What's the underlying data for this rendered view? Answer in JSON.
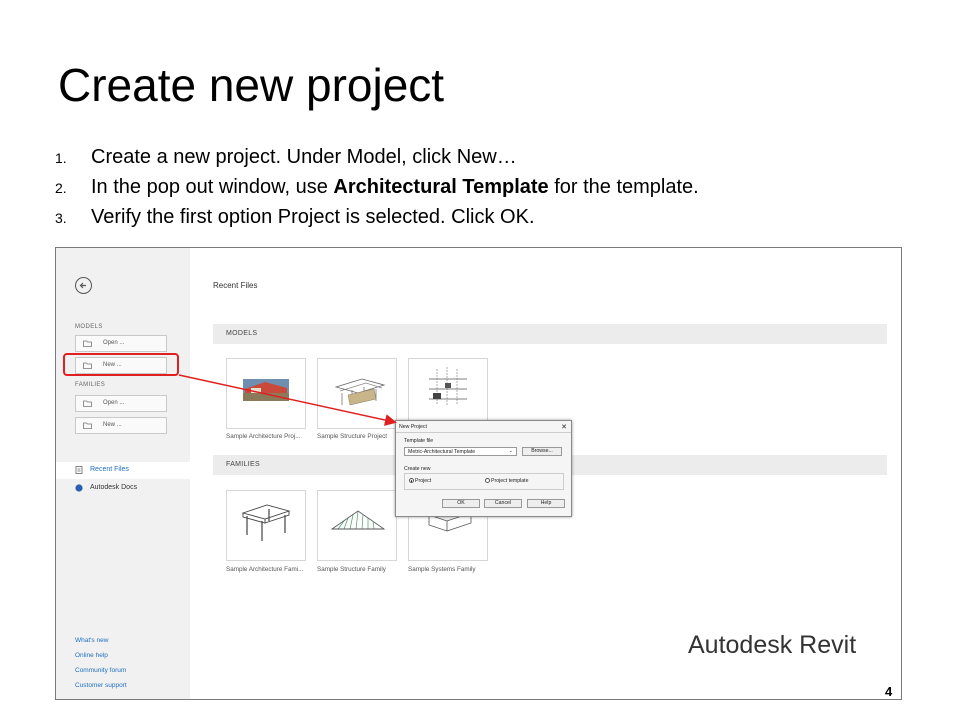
{
  "slide": {
    "title": "Create new project",
    "steps": [
      {
        "num": "1.",
        "text": "Create a new project. Under Model, click New…"
      },
      {
        "num": "2.",
        "pre": "In the pop out window, use ",
        "bold": "Architectural Template",
        "post": " for the template."
      },
      {
        "num": "3.",
        "text": "Verify the first option Project is selected. Click OK."
      }
    ],
    "page_number": "4"
  },
  "app": {
    "brand": "Autodesk Revit",
    "sidebar": {
      "back_icon": "arrow-left-circle-icon",
      "models_heading": "MODELS",
      "models_buttons": [
        {
          "label": "Open ...",
          "icon": "folder-open-icon"
        },
        {
          "label": "New ...",
          "icon": "folder-new-icon"
        }
      ],
      "families_heading": "FAMILIES",
      "families_buttons": [
        {
          "label": "Open ...",
          "icon": "folder-open-icon"
        },
        {
          "label": "New ...",
          "icon": "folder-new-icon"
        }
      ],
      "nav": [
        {
          "label": "Recent Files",
          "icon": "recent-files-icon",
          "active": true
        },
        {
          "label": "Autodesk Docs",
          "icon": "globe-icon",
          "active": false
        }
      ],
      "help_links": [
        "What's new",
        "Online help",
        "Community forum",
        "Customer support"
      ]
    },
    "main": {
      "title": "Recent Files",
      "models_section": "MODELS",
      "models": [
        {
          "label": "Sample Architecture Proj..."
        },
        {
          "label": "Sample Structure Project"
        },
        {
          "label": ""
        }
      ],
      "families_section": "FAMILIES",
      "families": [
        {
          "label": "Sample Architecture Fami..."
        },
        {
          "label": "Sample Structure Family"
        },
        {
          "label": "Sample Systems Family"
        }
      ]
    },
    "dialog": {
      "title": "New Project",
      "close": "✕",
      "template_label": "Template file",
      "template_value": "Metric-Architectural Template",
      "browse": "Browse...",
      "create_label": "Create new",
      "option_project": "Project",
      "option_template": "Project template",
      "selected": "Project",
      "ok": "OK",
      "cancel": "Cancel",
      "help": "Help"
    },
    "colors": {
      "highlight": "#e02020",
      "link": "#1f6fbf",
      "sidebar_bg": "#f1f1f1"
    }
  }
}
